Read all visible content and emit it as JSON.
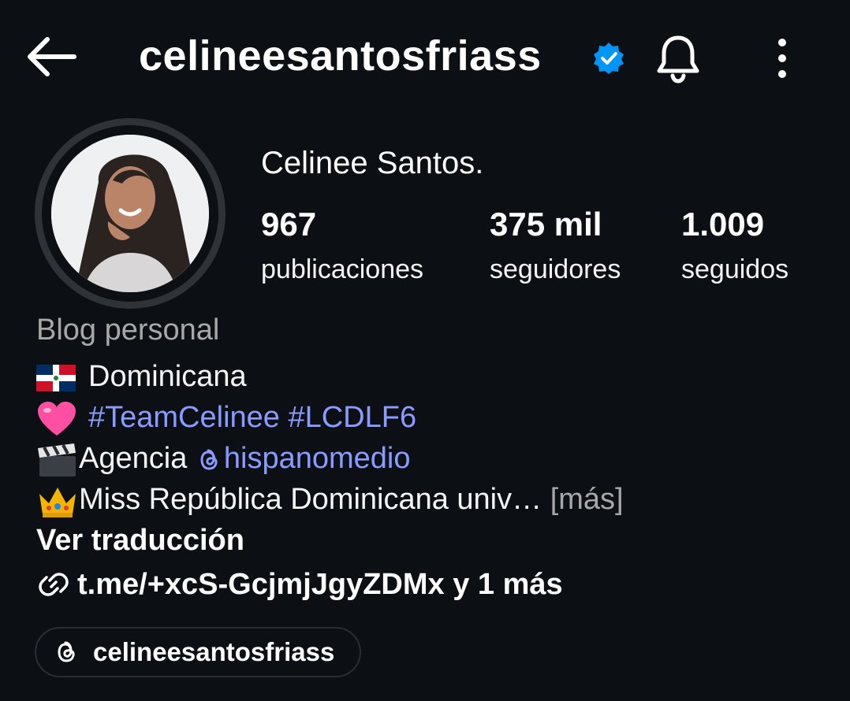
{
  "header": {
    "username": "celineesantosfriass",
    "icons": {
      "back": "back-arrow-icon",
      "verified": "verified-badge-icon",
      "notifications": "bell-icon",
      "more": "more-vertical-icon"
    },
    "verified_color": "#0095f6"
  },
  "profile": {
    "display_name": "Celinee Santos.",
    "stats": [
      {
        "count": "967",
        "label": "publicaciones"
      },
      {
        "count": "375 mil",
        "label": "seguidores"
      },
      {
        "count": "1.009",
        "label": "seguidos"
      }
    ],
    "category": "Blog personal",
    "bio": {
      "line1_text": "Dominicana",
      "line2_tags": "#TeamCelinee #LCDLF6",
      "line3_text": "Agencia ",
      "line3_mention": "hispanomedio",
      "line4_text": "Miss República Dominicana univ…",
      "line4_more": " [más]"
    },
    "see_translation": "Ver traducción",
    "link_text": "t.me/+xcS-GcjmjJgyZDMx y 1 más",
    "threads_handle": "celineesantosfriass"
  },
  "colors": {
    "background": "#0c1014",
    "link_blue": "#8a9bff",
    "muted": "#a8a8a8"
  }
}
